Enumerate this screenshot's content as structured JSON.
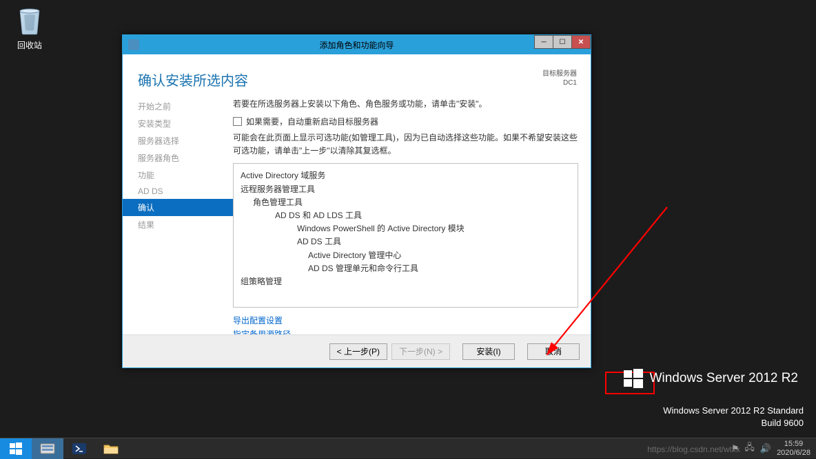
{
  "desktop": {
    "recycle_bin_label": "回收站"
  },
  "window": {
    "title": "添加角色和功能向导",
    "heading": "确认安装所选内容",
    "target_label": "目标服务器",
    "target_value": "DC1"
  },
  "sidebar": {
    "items": [
      {
        "label": "开始之前",
        "active": false
      },
      {
        "label": "安装类型",
        "active": false
      },
      {
        "label": "服务器选择",
        "active": false
      },
      {
        "label": "服务器角色",
        "active": false
      },
      {
        "label": "功能",
        "active": false
      },
      {
        "label": "AD DS",
        "active": false
      },
      {
        "label": "确认",
        "active": true
      },
      {
        "label": "结果",
        "active": false
      }
    ]
  },
  "content": {
    "intro": "若要在所选服务器上安装以下角色、角色服务或功能，请单击\"安装\"。",
    "checkbox_label": "如果需要，自动重新启动目标服务器",
    "explain": "可能会在此页面上显示可选功能(如管理工具)，因为已自动选择这些功能。如果不希望安装这些可选功能，请单击\"上一步\"以清除其复选框。",
    "features": [
      {
        "level": 0,
        "text": "Active Directory 域服务"
      },
      {
        "level": 0,
        "text": "远程服务器管理工具"
      },
      {
        "level": 1,
        "text": "角色管理工具"
      },
      {
        "level": 2,
        "text": "AD DS 和 AD LDS 工具"
      },
      {
        "level": 3,
        "text": "Windows PowerShell 的 Active Directory 模块"
      },
      {
        "level": 3,
        "text": "AD DS 工具"
      },
      {
        "level": 4,
        "text": "Active Directory 管理中心"
      },
      {
        "level": 4,
        "text": "AD DS 管理单元和命令行工具"
      },
      {
        "level": 0,
        "text": "组策略管理"
      }
    ],
    "link_export": "导出配置设置",
    "link_path": "指定备用源路径"
  },
  "footer": {
    "prev": "< 上一步(P)",
    "next": "下一步(N) >",
    "install": "安装(I)",
    "cancel": "取消"
  },
  "brand": {
    "name": "Windows Server 2012 R2",
    "edition": "Windows Server 2012 R2 Standard",
    "build": "Build 9600"
  },
  "tray": {
    "time": "15:59",
    "date": "2020/6/28"
  },
  "watermark": "https://blog.csdn.net/wtxx"
}
